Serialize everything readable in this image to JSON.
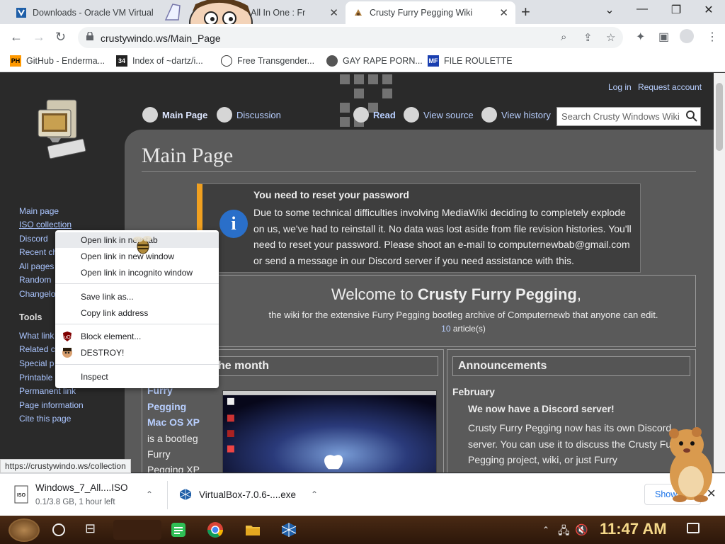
{
  "browser": {
    "tabs": [
      {
        "title": "Downloads - Oracle VM Virtual",
        "close": "✕"
      },
      {
        "title": "g 7 All In One : Fr",
        "close": "✕"
      },
      {
        "title": "Crusty Furry Pegging Wiki",
        "close": "✕",
        "active": true
      }
    ],
    "new_tab": "+",
    "window_controls": {
      "minimize": "⌄",
      "restore": "—",
      "maximize": "❐",
      "close": "✕"
    },
    "url": "crustywindo.ws/Main_Page",
    "bookmarks": [
      {
        "icon": "PH",
        "label": "GitHub - Enderma..."
      },
      {
        "icon": "34",
        "label": "Index of ~dartz/i..."
      },
      {
        "icon": "mask-icon",
        "label": "Free Transgender..."
      },
      {
        "icon": "globe-icon",
        "label": "GAY RAPE PORN..."
      },
      {
        "icon": "MF",
        "label": "FILE ROULETTE"
      }
    ]
  },
  "wiki": {
    "personal": {
      "login": "Log in",
      "request": "Request account"
    },
    "page_tabs": [
      {
        "label": "Main Page",
        "active": true
      },
      {
        "label": "Discussion"
      },
      {
        "label": "Read"
      },
      {
        "label": "View source"
      },
      {
        "label": "View history"
      }
    ],
    "search_placeholder": "Search Crusty Windows Wiki",
    "sidebar_nav": [
      "Main page",
      "ISO collection",
      "Discord",
      "Recent cha",
      "All pages",
      "Random",
      "Changelo"
    ],
    "tools_heading": "Tools",
    "sidebar_tools": [
      "What link",
      "Related c",
      "Special p",
      "Printable",
      "Permanent link",
      "Page information",
      "Cite this page"
    ],
    "title": "Main Page",
    "notice": {
      "title": "You need to reset your password",
      "body": "Due to some technical difficulties involving MediaWiki deciding to completely explode on us, we've had to reinstall it. No data was lost aside from file revision histories. You'll need to reset your password. Please shoot an e-mail to computernewbab@gmail.com or send a message in our Discord server if you need assistance with this.",
      "icon": "i"
    },
    "welcome": {
      "prefix": "Welcome to ",
      "name": "Crusty Furry Pegging",
      "suffix": ",",
      "subtitle": "the wiki for the extensive Furry Pegging bootleg archive of Computernewb that anyone can edit.",
      "count": "10",
      "count_label": " article(s)"
    },
    "featured": {
      "heading": "he month",
      "links": [
        "Furry",
        "Pegging",
        "Mac OS XP"
      ],
      "text": [
        "is a bootleg",
        "Furry",
        "Pegging XP"
      ]
    },
    "announcements": {
      "heading": "Announcements",
      "month": "February",
      "title": "We now have a Discord server!",
      "body": "Crusty Furry Pegging now has its own Discord server. You can use it to discuss the Crusty Fu Pegging project, wiki, or just Furry Pegging/Linux/MS-DOS/... bootlegs in genera"
    },
    "status_url": "https://crustywindo.ws/collection"
  },
  "context_menu": {
    "items": [
      {
        "label": "Open link in new tab",
        "highlighted": true
      },
      {
        "label": "Open link in new window"
      },
      {
        "label": "Open link in incognito window"
      },
      {
        "label": "Save link as..."
      },
      {
        "label": "Copy link address"
      },
      {
        "label": "Block element...",
        "icon": "ublock-icon"
      },
      {
        "label": "DESTROY!",
        "icon": "face-icon"
      },
      {
        "label": "Inspect"
      }
    ]
  },
  "downloads": {
    "items": [
      {
        "name": "Windows_7_All....ISO",
        "status": "0.1/3.8 GB, 1 hour left"
      },
      {
        "name": "VirtualBox-7.0.6-....exe",
        "status": ""
      }
    ],
    "show_all": "Show",
    "close": "✕"
  },
  "taskbar": {
    "clock": "11:47 AM"
  },
  "colors": {
    "link": "#b8cfff",
    "page_bg": "#2a2a2a",
    "content_bg": "#5a5a5a",
    "notice_accent": "#f0a020",
    "clock": "#f5d889"
  }
}
